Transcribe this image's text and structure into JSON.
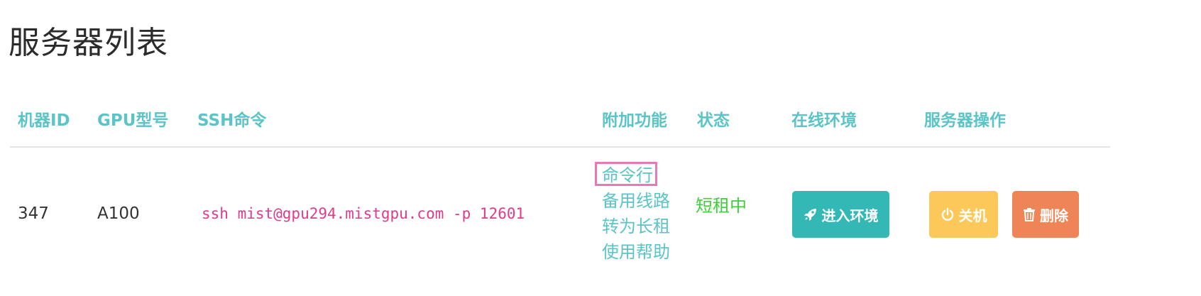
{
  "page": {
    "title": "服务器列表"
  },
  "table": {
    "headers": {
      "machine_id": "机器ID",
      "gpu_model": "GPU型号",
      "ssh_command": "SSH命令",
      "features": "附加功能",
      "status": "状态",
      "online_env": "在线环境",
      "server_ops": "服务器操作"
    },
    "rows": [
      {
        "machine_id": "347",
        "gpu_model": "A100",
        "ssh_command": "ssh mist@gpu294.mistgpu.com -p 12601",
        "features": [
          "命令行",
          "备用线路",
          "转为长租",
          "使用帮助"
        ],
        "status": "短租中",
        "enter_env_label": "进入环境",
        "shutdown_label": "关机",
        "delete_label": "删除"
      }
    ]
  },
  "colors": {
    "accent_teal": "#5bc4c6",
    "status_green": "#3ecf3a",
    "ssh_pink": "#e03a8a",
    "enter_button": "#33b8b5",
    "shutdown_button": "#fcc85a",
    "delete_button": "#ef8556",
    "focus_outline": "#e879b9"
  },
  "icons": {
    "enter_env": "rocket-icon",
    "shutdown": "power-icon",
    "delete": "trash-icon"
  }
}
